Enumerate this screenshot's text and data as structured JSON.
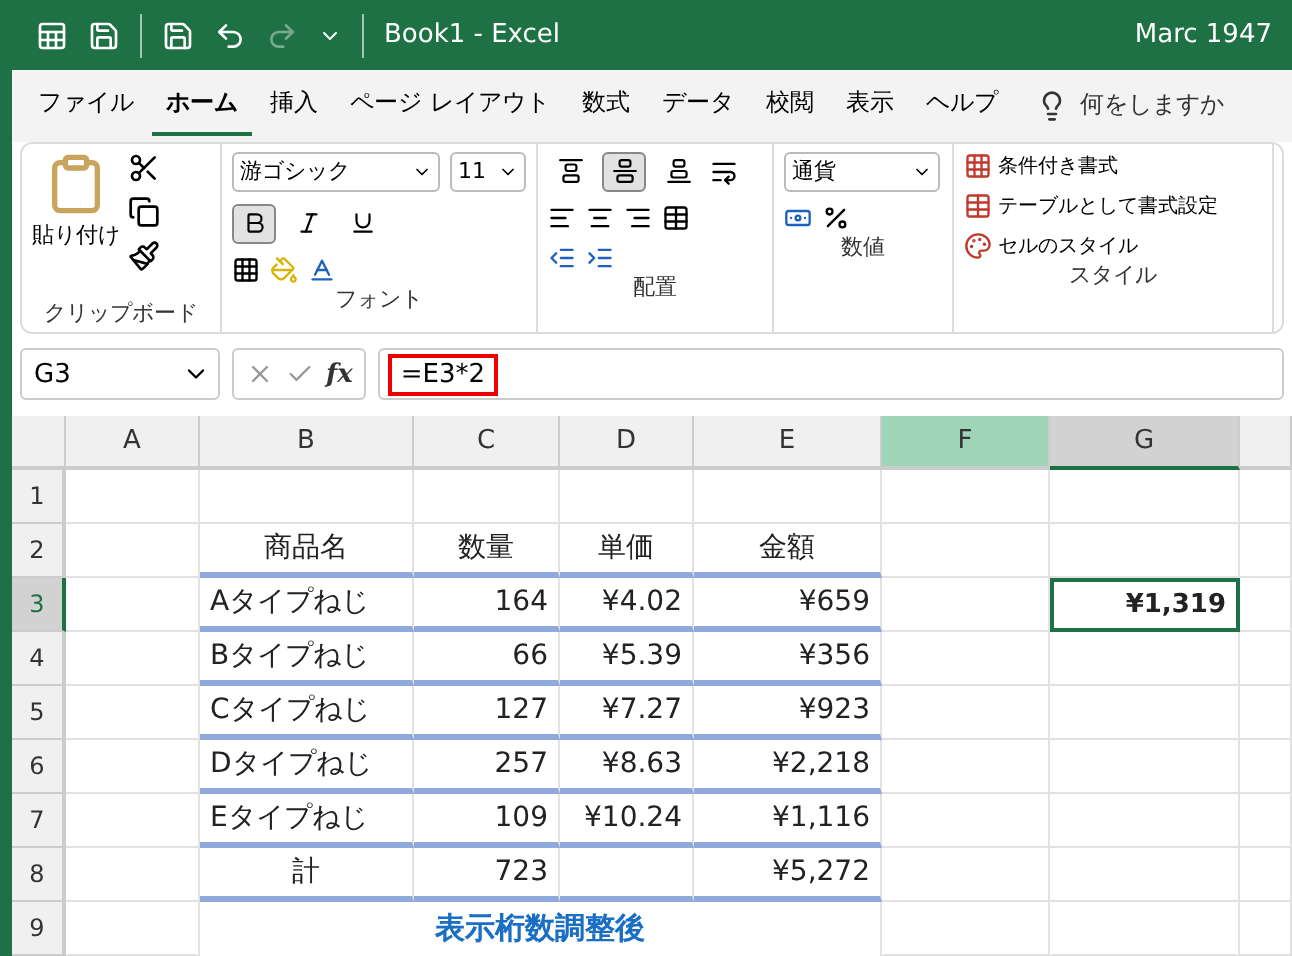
{
  "title_bar": {
    "title": "Book1  -  Excel",
    "user": "Marc 1947",
    "redo_disabled": true
  },
  "menu": {
    "tabs": [
      {
        "label": "ファイル",
        "selected": false
      },
      {
        "label": "ホーム",
        "selected": true
      },
      {
        "label": "挿入",
        "selected": false
      },
      {
        "label": "ページ レイアウト",
        "selected": false
      },
      {
        "label": "数式",
        "selected": false
      },
      {
        "label": "データ",
        "selected": false
      },
      {
        "label": "校閲",
        "selected": false
      },
      {
        "label": "表示",
        "selected": false
      },
      {
        "label": "ヘルプ",
        "selected": false
      }
    ],
    "search": {
      "placeholder": "何をしますか"
    }
  },
  "ribbon": {
    "clipboard": {
      "paste": "貼り付け",
      "label": "クリップボード"
    },
    "font": {
      "name": "游ゴシック",
      "size": "11",
      "label": "フォント",
      "buttons": [
        {
          "kind": "bold",
          "selected": true
        },
        {
          "kind": "italic",
          "selected": false
        },
        {
          "kind": "underline",
          "selected": false
        }
      ]
    },
    "alignment": {
      "label": "配置",
      "buttons": [
        {
          "kind": "top",
          "selected": false
        },
        {
          "kind": "middle",
          "selected": true
        },
        {
          "kind": "bottom",
          "selected": false
        }
      ]
    },
    "number": {
      "format": "通貨",
      "label": "数値"
    },
    "styles": {
      "label": "スタイル",
      "items": [
        {
          "kind": "conditional",
          "label": "条件付き書式"
        },
        {
          "kind": "table",
          "label": "テーブルとして書式設定"
        },
        {
          "kind": "cell",
          "label": "セルのスタイル"
        }
      ]
    }
  },
  "formula_bar": {
    "name_box": "G3",
    "function_label": "fx",
    "formula": "=E3*2",
    "formula_highlighted": true
  },
  "grid": {
    "columns": [
      {
        "label": "A",
        "highlighted": false,
        "selected": false
      },
      {
        "label": "B",
        "highlighted": false,
        "selected": false
      },
      {
        "label": "C",
        "highlighted": false,
        "selected": false
      },
      {
        "label": "D",
        "highlighted": false,
        "selected": false
      },
      {
        "label": "E",
        "highlighted": false,
        "selected": false
      },
      {
        "label": "F",
        "highlighted": true,
        "selected": false
      },
      {
        "label": "G",
        "highlighted": false,
        "selected": true
      }
    ],
    "rows": [
      {
        "label": "1",
        "selected": false
      },
      {
        "label": "2",
        "selected": false,
        "table_cells": [
          {
            "kind": "heading",
            "text": "商品名"
          },
          {
            "kind": "heading",
            "text": "数量"
          },
          {
            "kind": "heading",
            "text": "単価"
          },
          {
            "kind": "heading",
            "text": "金額"
          }
        ]
      },
      {
        "label": "3",
        "selected": true,
        "table_cells": [
          {
            "kind": "name",
            "text": "Aタイプねじ"
          },
          {
            "kind": "number",
            "text": "164"
          },
          {
            "kind": "number",
            "text": "¥4.02"
          },
          {
            "kind": "number",
            "text": "¥659"
          }
        ],
        "side_cell": {
          "text": "¥1,319",
          "selected": true
        }
      },
      {
        "label": "4",
        "selected": false,
        "table_cells": [
          {
            "kind": "name",
            "text": "Bタイプねじ"
          },
          {
            "kind": "number",
            "text": "66"
          },
          {
            "kind": "number",
            "text": "¥5.39"
          },
          {
            "kind": "number",
            "text": "¥356"
          }
        ]
      },
      {
        "label": "5",
        "selected": false,
        "table_cells": [
          {
            "kind": "name",
            "text": "Cタイプねじ"
          },
          {
            "kind": "number",
            "text": "127"
          },
          {
            "kind": "number",
            "text": "¥7.27"
          },
          {
            "kind": "number",
            "text": "¥923"
          }
        ]
      },
      {
        "label": "6",
        "selected": false,
        "table_cells": [
          {
            "kind": "name",
            "text": "Dタイプねじ"
          },
          {
            "kind": "number",
            "text": "257"
          },
          {
            "kind": "number",
            "text": "¥8.63"
          },
          {
            "kind": "number",
            "text": "¥2,218"
          }
        ]
      },
      {
        "label": "7",
        "selected": false,
        "table_cells": [
          {
            "kind": "name",
            "text": "Eタイプねじ"
          },
          {
            "kind": "number",
            "text": "109"
          },
          {
            "kind": "number",
            "text": "¥10.24"
          },
          {
            "kind": "number",
            "text": "¥1,116"
          }
        ]
      },
      {
        "label": "8",
        "selected": false,
        "table_cells": [
          {
            "kind": "heading",
            "text": "計"
          },
          {
            "kind": "number",
            "text": "723"
          },
          {
            "kind": "empty"
          },
          {
            "kind": "number",
            "text": "¥5,272"
          }
        ]
      },
      {
        "label": "9",
        "selected": false,
        "caption": "表示桁数調整後"
      }
    ]
  }
}
